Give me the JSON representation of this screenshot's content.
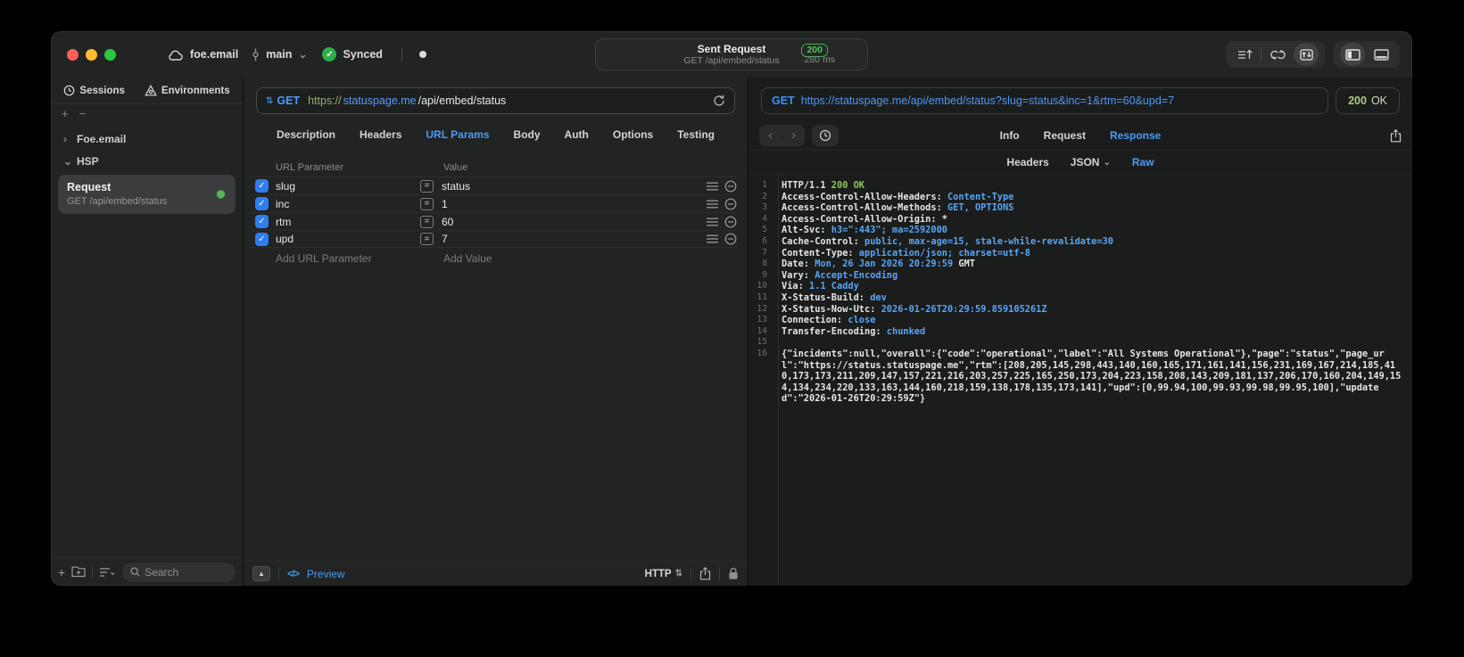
{
  "icons": {
    "chevron_right": "›",
    "chevron_down": "⌄",
    "plus": "+",
    "minus": "−",
    "check": "✓",
    "method_caret": "⇅",
    "popup_caret": "⇅",
    "triangle_up": "▲",
    "code_glyph": "</>",
    "equals": "=",
    "back": "‹",
    "forward": "›"
  },
  "titlebar": {
    "project": "foe.email",
    "branch": "main",
    "sync_label": "Synced",
    "request_summary": {
      "title": "Sent Request",
      "method_path": "GET /api/embed/status",
      "status_code": "200",
      "duration": "280 ms"
    }
  },
  "sidebar": {
    "tabs": [
      {
        "label": "Sessions",
        "icon": "history-clock-icon"
      },
      {
        "label": "Environments",
        "icon": "environments-icon"
      }
    ],
    "tree": [
      {
        "label": "Foe.email",
        "state": "collapsed"
      },
      {
        "label": "HSP",
        "state": "expanded"
      }
    ],
    "request_item": {
      "title": "Request",
      "subtitle": "GET /api/embed/status",
      "status_color": "#58b55c"
    },
    "search_placeholder": "Search"
  },
  "request_editor": {
    "method": "GET",
    "url": {
      "scheme": "https://",
      "host": "statuspage.me",
      "path": "/api/embed/status"
    },
    "tabs": [
      "Description",
      "Headers",
      "URL Params",
      "Body",
      "Auth",
      "Options",
      "Testing"
    ],
    "active_tab": "URL Params",
    "params": {
      "columns": [
        "URL Parameter",
        "Value"
      ],
      "rows": [
        {
          "name": "slug",
          "value": "status",
          "enabled": true
        },
        {
          "name": "inc",
          "value": "1",
          "enabled": true
        },
        {
          "name": "rtm",
          "value": "60",
          "enabled": true
        },
        {
          "name": "upd",
          "value": "7",
          "enabled": true
        }
      ],
      "add_name_placeholder": "Add URL Parameter",
      "add_value_placeholder": "Add Value"
    },
    "footer": {
      "preview_label": "Preview",
      "protocol_selector": "HTTP"
    }
  },
  "response_viewer": {
    "request_line": {
      "method": "GET",
      "url": "https://statuspage.me/api/embed/status?slug=status&inc=1&rtm=60&upd=7"
    },
    "status": {
      "code": "200",
      "text": "OK"
    },
    "tabs": [
      "Info",
      "Request",
      "Response"
    ],
    "active_tab": "Response",
    "subtabs": [
      "Headers",
      "JSON",
      "Raw"
    ],
    "active_subtab": "Raw",
    "colors": {
      "value_blue": "#58a6f5",
      "status_green": "#8fc65c"
    },
    "body_lines": [
      {
        "n": "1",
        "seg": [
          [
            "HTTP/1.1 ",
            "p"
          ],
          [
            "200 OK",
            "g"
          ]
        ]
      },
      {
        "n": "2",
        "seg": [
          [
            "Access-Control-Allow-Headers: ",
            "p"
          ],
          [
            "Content-Type",
            "b"
          ]
        ]
      },
      {
        "n": "3",
        "seg": [
          [
            "Access-Control-Allow-Methods: ",
            "p"
          ],
          [
            "GET, OPTIONS",
            "b"
          ]
        ]
      },
      {
        "n": "4",
        "seg": [
          [
            "Access-Control-Allow-Origin: ",
            "p"
          ],
          [
            "*",
            "p"
          ]
        ]
      },
      {
        "n": "5",
        "seg": [
          [
            "Alt-Svc: ",
            "p"
          ],
          [
            "h3=\":443\"; ma=2592000",
            "b"
          ]
        ]
      },
      {
        "n": "6",
        "seg": [
          [
            "Cache-Control: ",
            "p"
          ],
          [
            "public, max-age=15, stale-while-revalidate=30",
            "b"
          ]
        ]
      },
      {
        "n": "7",
        "seg": [
          [
            "Content-Type: ",
            "p"
          ],
          [
            "application/json; charset=utf-8",
            "b"
          ]
        ]
      },
      {
        "n": "8",
        "seg": [
          [
            "Date: ",
            "p"
          ],
          [
            "Mon, 26 Jan 2026 20:29:59",
            "b"
          ],
          [
            " GMT",
            "p"
          ]
        ]
      },
      {
        "n": "9",
        "seg": [
          [
            "Vary: ",
            "p"
          ],
          [
            "Accept-Encoding",
            "b"
          ]
        ]
      },
      {
        "n": "10",
        "seg": [
          [
            "Via: ",
            "p"
          ],
          [
            "1.1 Caddy",
            "b"
          ]
        ]
      },
      {
        "n": "11",
        "seg": [
          [
            "X-Status-Build: ",
            "p"
          ],
          [
            "dev",
            "b"
          ]
        ]
      },
      {
        "n": "12",
        "seg": [
          [
            "X-Status-Now-Utc: ",
            "p"
          ],
          [
            "2026-01-26T20:29:59.859105261Z",
            "b"
          ]
        ]
      },
      {
        "n": "13",
        "seg": [
          [
            "Connection: ",
            "p"
          ],
          [
            "close",
            "b"
          ]
        ]
      },
      {
        "n": "14",
        "seg": [
          [
            "Transfer-Encoding: ",
            "p"
          ],
          [
            "chunked",
            "b"
          ]
        ]
      },
      {
        "n": "15",
        "seg": []
      },
      {
        "n": "16",
        "seg": [
          [
            "{\"incidents\":null,\"overall\":{\"code\":\"operational\",\"label\":\"All Systems Operational\"},\"page\":\"status\",\"page_url\":\"https://status.statuspage.me\",\"rtm\":[208,205,145,298,443,140,160,165,171,161,141,156,231,169,167,214,185,410,173,173,211,209,147,157,221,216,203,257,225,165,250,173,204,223,158,208,143,209,181,137,206,170,160,204,149,154,134,234,220,133,163,144,160,218,159,138,178,135,173,141],\"upd\":[0,99.94,100,99.93,99.98,99.95,100],\"updated\":\"2026-01-26T20:29:59Z\"}",
            "p"
          ]
        ]
      }
    ]
  }
}
